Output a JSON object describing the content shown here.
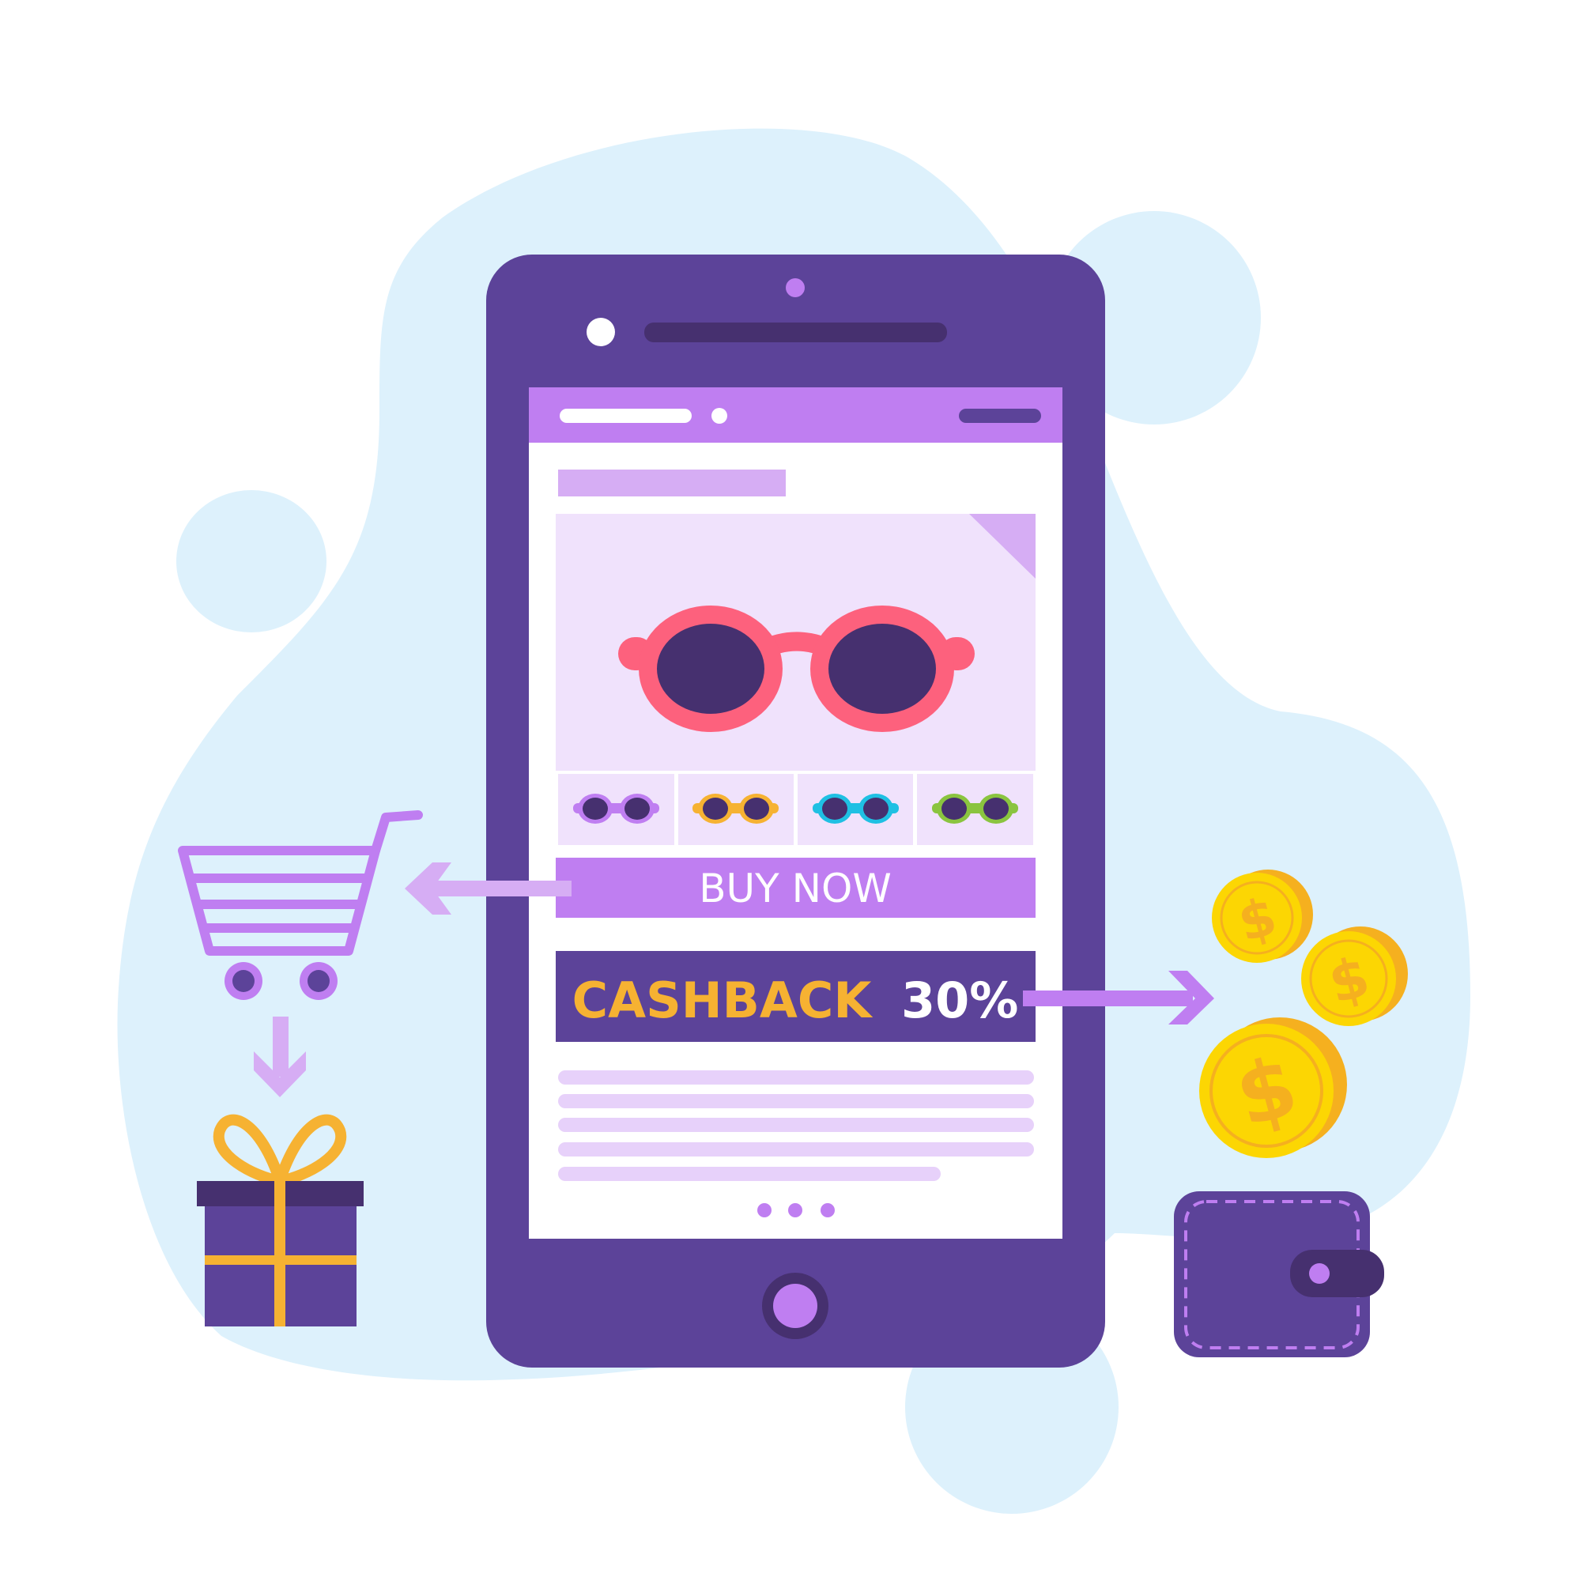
{
  "promo": {
    "buy_now_label": "BUY NOW",
    "cashback_word": "CASHBACK",
    "cashback_percent": "30%"
  },
  "coins": {
    "symbol": "$"
  },
  "colors": {
    "background_blob": "#ddf1fc",
    "phone_body": "#5c4399",
    "phone_dark": "#46306f",
    "accent_purple": "#bf7ef1",
    "light_purple": "#d6adf4",
    "product_bg": "#f0e2fc",
    "sunglasses_frame": "#fd617d",
    "sunglasses_lens": "#46306f",
    "cashback_text": "#f6b232",
    "coin_gold": "#fcd603",
    "coin_orange": "#f5b01f",
    "gift_ribbon": "#f6b232"
  },
  "icons": [
    "sunglasses-icon",
    "shopping-cart-icon",
    "gift-box-icon",
    "coin-icon",
    "wallet-icon",
    "arrow-left-icon",
    "arrow-right-icon",
    "arrow-down-icon"
  ],
  "product_variants": [
    {
      "frame_color": "#bf7ef1"
    },
    {
      "frame_color": "#f6b232"
    },
    {
      "frame_color": "#1fc0e3"
    },
    {
      "frame_color": "#8ac43f"
    }
  ]
}
